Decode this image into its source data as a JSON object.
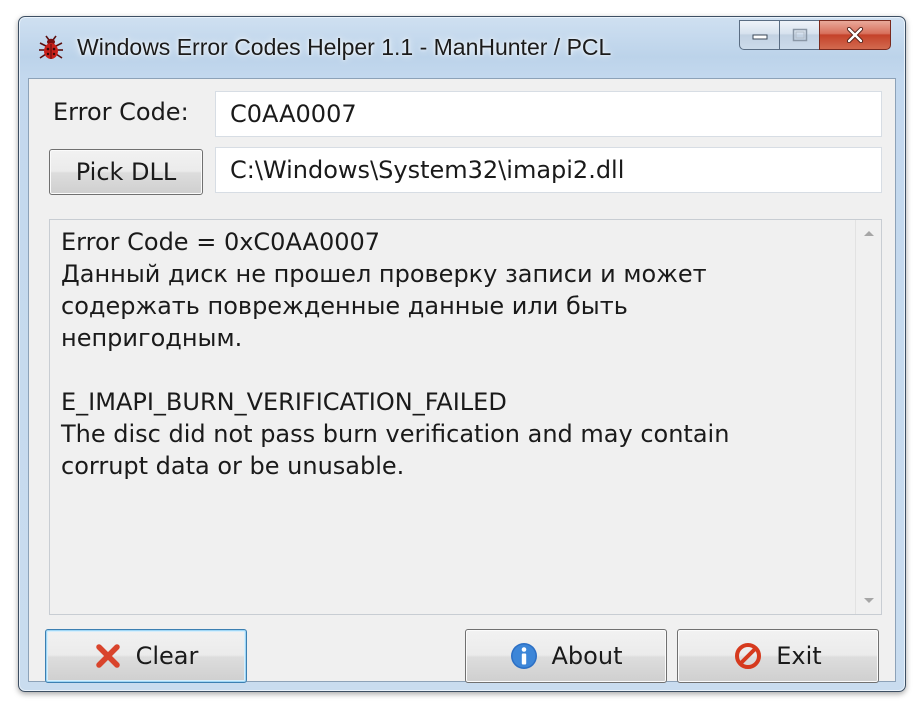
{
  "window": {
    "title": "Windows Error Codes Helper 1.1 - ManHunter / PCL"
  },
  "icons": {
    "app": "bug-icon",
    "minimize": "minimize-icon",
    "maximize": "maximize-icon",
    "close": "close-icon",
    "clear": "red-x-icon",
    "about": "info-icon",
    "exit": "no-entry-icon",
    "scroll_up": "arrow-up-icon",
    "scroll_down": "arrow-down-icon"
  },
  "error_code": {
    "label": "Error Code:",
    "value": "C0AA0007"
  },
  "dll": {
    "button_label": "Pick DLL",
    "path": "C:\\Windows\\System32\\imapi2.dll"
  },
  "output": {
    "text": "Error Code = 0xC0AA0007\nДанный диск не прошел проверку записи и может\nсодержать поврежденные данные или быть\nнепригодным.\n\nE_IMAPI_BURN_VERIFICATION_FAILED\nThe disc did not pass burn verification and may contain\ncorrupt data or be unusable."
  },
  "buttons": {
    "clear": "Clear",
    "about": "About",
    "exit": "Exit"
  },
  "colors": {
    "clear_icon": "#d9442c",
    "about_icon": "#2c6fc4",
    "exit_icon": "#d63a1e"
  }
}
